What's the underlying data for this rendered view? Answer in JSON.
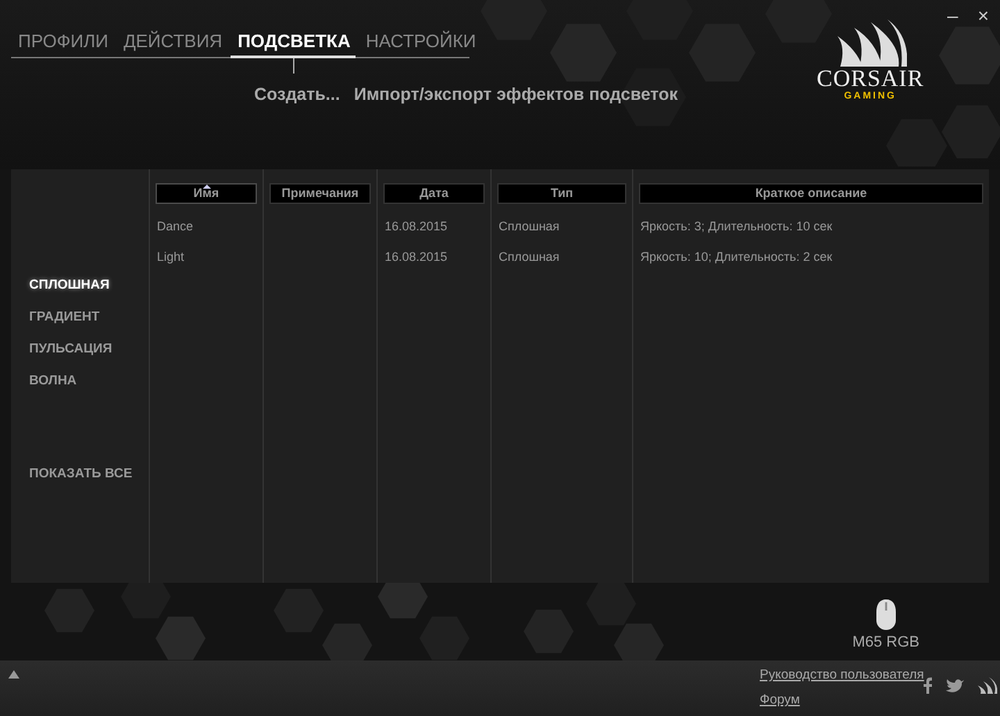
{
  "window": {
    "controls": [
      "–",
      "×"
    ]
  },
  "tabs": [
    {
      "label": "ПРОФИЛИ",
      "selected": false
    },
    {
      "label": "ДЕЙСТВИЯ",
      "selected": false
    },
    {
      "label": "ПОДСВЕТКА",
      "selected": true
    },
    {
      "label": "НАСТРОЙКИ",
      "selected": false
    }
  ],
  "actions": [
    "Создать...",
    "Импорт/экспорт эффектов подсветок"
  ],
  "logo": {
    "brand": "CORSAIR",
    "sub": "GAMING"
  },
  "effect_types": [
    {
      "label": "СПЛОШНАЯ",
      "selected": true
    },
    {
      "label": "ГРАДИЕНТ",
      "selected": false
    },
    {
      "label": "ПУЛЬСАЦИЯ",
      "selected": false
    },
    {
      "label": "ВОЛНА",
      "selected": false
    }
  ],
  "show_all": "ПОКАЗАТЬ ВСЕ",
  "table": {
    "columns": [
      {
        "label": "Имя",
        "sorted": true
      },
      {
        "label": "Примечания",
        "sorted": false
      },
      {
        "label": "Дата",
        "sorted": false
      },
      {
        "label": "Тип",
        "sorted": false
      },
      {
        "label": "Краткое описание",
        "sorted": false
      }
    ],
    "rows": [
      [
        "Dance",
        "",
        "16.08.2015",
        "Сплошная",
        "Яркость: 3; Длительность: 10 сек"
      ],
      [
        "Light",
        "",
        "16.08.2015",
        "Сплошная",
        "Яркость: 10; Длительность: 2 сек"
      ]
    ]
  },
  "device": {
    "name": "M65 RGB"
  },
  "footer": {
    "links": [
      "Руководство пользователя",
      "Форум"
    ]
  }
}
